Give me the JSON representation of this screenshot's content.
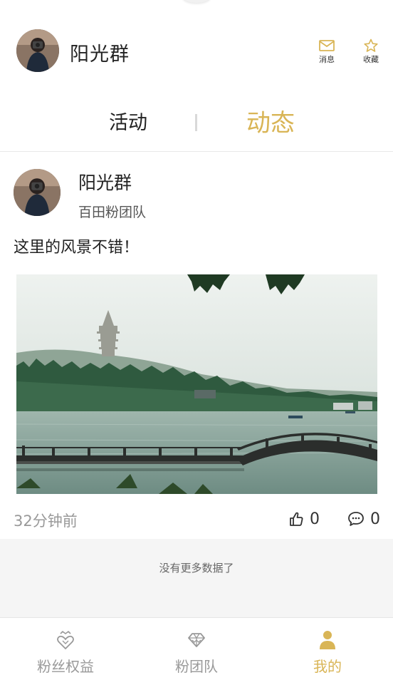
{
  "header": {
    "group_name": "阳光群",
    "messages_label": "消息",
    "favorites_label": "收藏"
  },
  "tabs": [
    {
      "label": "活动",
      "active": false
    },
    {
      "label": "动态",
      "active": true
    }
  ],
  "post": {
    "author": "阳光群",
    "team": "百田粉团队",
    "content": "这里的风景不错！",
    "time": "32分钟前",
    "likes": "0",
    "comments": "0"
  },
  "footer_note": "没有更多数据了",
  "bottom_nav": [
    {
      "label": "粉丝权益",
      "icon": "heart-crown-icon",
      "active": false
    },
    {
      "label": "粉团队",
      "icon": "diamond-icon",
      "active": false
    },
    {
      "label": "我的",
      "icon": "person-icon",
      "active": true
    }
  ],
  "colors": {
    "accent": "#d9b556",
    "text": "#222222",
    "muted": "#999999",
    "background_gray": "#f5f5f5"
  }
}
